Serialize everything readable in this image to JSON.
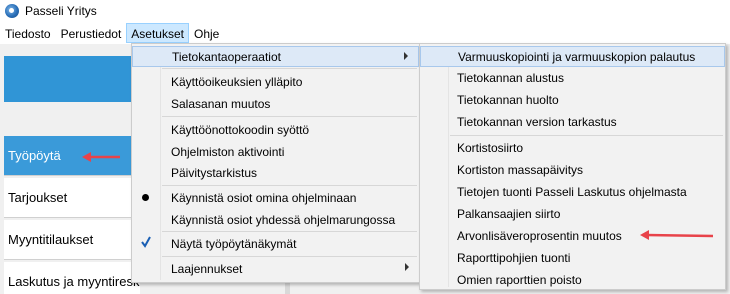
{
  "window": {
    "title": "Passeli Yritys"
  },
  "menubar": {
    "items": [
      {
        "label": "Tiedosto"
      },
      {
        "label": "Perustiedot"
      },
      {
        "label": "Asetukset"
      },
      {
        "label": "Ohje"
      }
    ]
  },
  "nav": {
    "items": [
      {
        "label": "Työpöytä"
      },
      {
        "label": "Tarjoukset"
      },
      {
        "label": "Myyntitilaukset"
      },
      {
        "label": "Laskutus ja myyntireskontra"
      }
    ]
  },
  "asetukset_menu": {
    "items": [
      {
        "label": "Tietokantaoperaatiot"
      },
      {
        "label": "Käyttöoikeuksien ylläpito"
      },
      {
        "label": "Salasanan muutos"
      },
      {
        "label": "Käyttöönottokoodin syöttö"
      },
      {
        "label": "Ohjelmiston aktivointi"
      },
      {
        "label": "Päivitystarkistus"
      },
      {
        "label": "Käynnistä osiot omina ohjelminaan"
      },
      {
        "label": "Käynnistä osiot yhdessä ohjelmarungossa"
      },
      {
        "label": "Näytä työpöytänäkymät"
      },
      {
        "label": "Laajennukset"
      }
    ]
  },
  "tietokanta_submenu": {
    "items": [
      {
        "label": "Varmuuskopiointi ja varmuuskopion palautus"
      },
      {
        "label": "Tietokannan alustus"
      },
      {
        "label": "Tietokannan huolto"
      },
      {
        "label": "Tietokannan version tarkastus"
      },
      {
        "label": "Kortistosiirto"
      },
      {
        "label": "Kortiston massapäivitys"
      },
      {
        "label": "Tietojen tuonti Passeli Laskutus ohjelmasta"
      },
      {
        "label": "Palkansaajien siirto"
      },
      {
        "label": "Arvonlisäveroprosentin muutos"
      },
      {
        "label": "Raporttipohjien tuonti"
      },
      {
        "label": "Omien raporttien poisto"
      }
    ]
  },
  "colors": {
    "accent": "#3095d6",
    "selected_nav": "#3a9ad9",
    "annotation_arrow": "#e8434a"
  }
}
